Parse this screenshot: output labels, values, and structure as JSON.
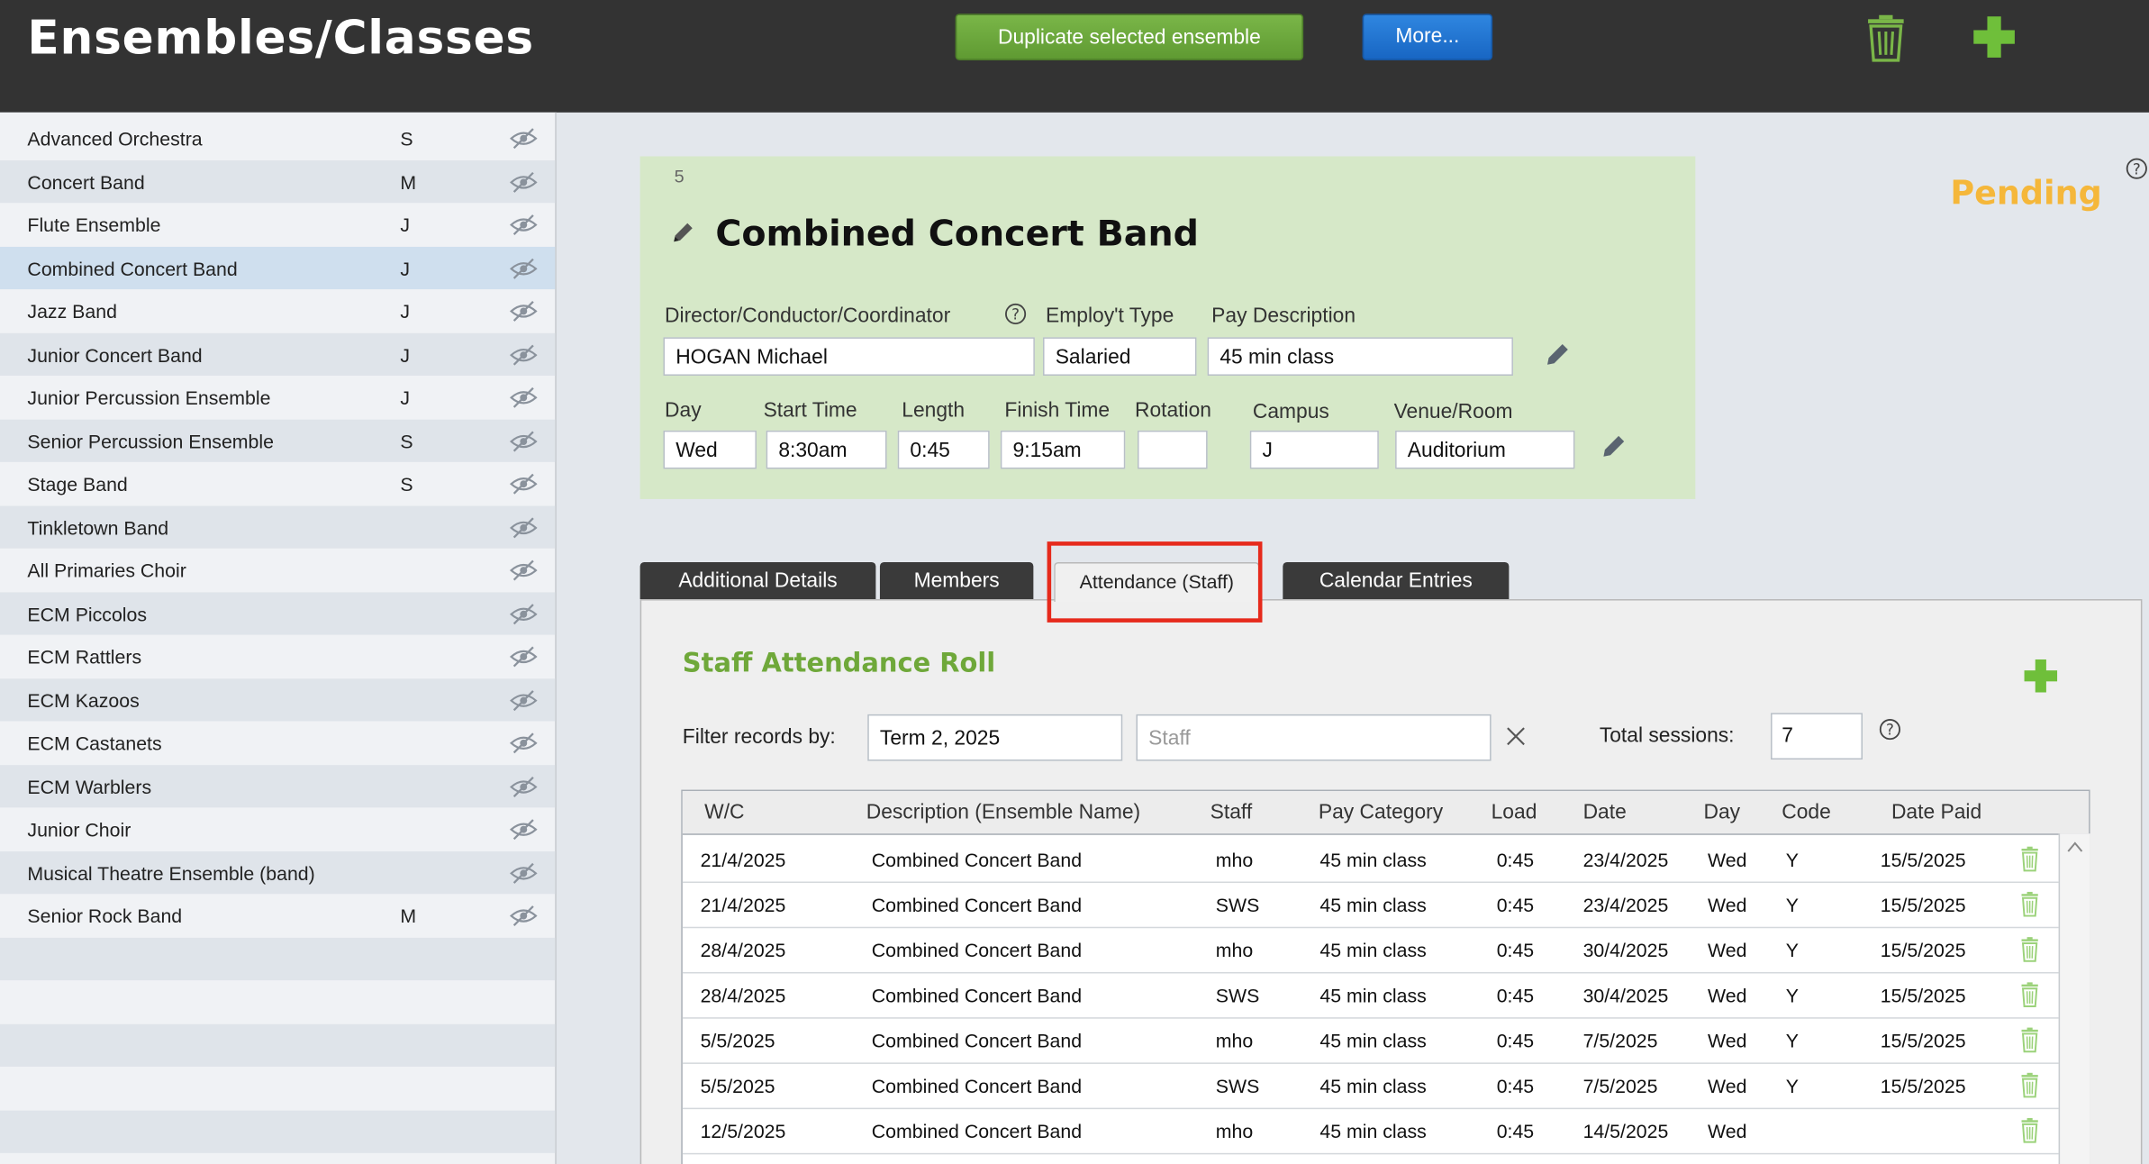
{
  "header": {
    "title": "Ensembles/Classes",
    "duplicate_label": "Duplicate selected ensemble",
    "more_label": "More...",
    "trash_icon": "trash-icon",
    "add_icon": "plus-icon"
  },
  "sidebar": {
    "items": [
      {
        "name": "Advanced Orchestra",
        "code": "S"
      },
      {
        "name": "Concert Band",
        "code": "M"
      },
      {
        "name": "Flute Ensemble",
        "code": "J"
      },
      {
        "name": "Combined Concert Band",
        "code": "J"
      },
      {
        "name": "Jazz Band",
        "code": "J"
      },
      {
        "name": "Junior Concert Band",
        "code": "J"
      },
      {
        "name": "Junior Percussion Ensemble",
        "code": "J"
      },
      {
        "name": "Senior Percussion Ensemble",
        "code": "S"
      },
      {
        "name": "Stage Band",
        "code": "S"
      },
      {
        "name": "Tinkletown Band",
        "code": ""
      },
      {
        "name": "All Primaries Choir",
        "code": ""
      },
      {
        "name": "ECM Piccolos",
        "code": ""
      },
      {
        "name": "ECM Rattlers",
        "code": ""
      },
      {
        "name": "ECM Kazoos",
        "code": ""
      },
      {
        "name": "ECM Castanets",
        "code": ""
      },
      {
        "name": "ECM Warblers",
        "code": ""
      },
      {
        "name": "Junior Choir",
        "code": ""
      },
      {
        "name": "Musical Theatre Ensemble (band)",
        "code": ""
      },
      {
        "name": "Senior Rock Band",
        "code": "M"
      }
    ]
  },
  "record": {
    "number": "5",
    "title": "Combined Concert Band",
    "status": "Pending",
    "labels": {
      "director": "Director/Conductor/Coordinator",
      "employ_type": "Employ't Type",
      "pay_desc": "Pay Description",
      "day": "Day",
      "start": "Start Time",
      "length": "Length",
      "finish": "Finish Time",
      "rotation": "Rotation",
      "campus": "Campus",
      "venue": "Venue/Room"
    },
    "values": {
      "director": "HOGAN Michael",
      "employ_type": "Salaried",
      "pay_desc": "45 min class",
      "day": "Wed",
      "start": "8:30am",
      "length": "0:45",
      "finish": "9:15am",
      "rotation": "",
      "campus": "J",
      "venue": "Auditorium"
    }
  },
  "tabs": {
    "additional": "Additional Details",
    "members": "Members",
    "attendance": "Attendance (Staff)",
    "calendar": "Calendar Entries"
  },
  "attendance": {
    "title": "Staff Attendance Roll",
    "filter_label": "Filter records by:",
    "term_value": "Term 2, 2025",
    "staff_placeholder": "Staff",
    "sessions_label": "Total sessions:",
    "sessions_value": "7",
    "columns": [
      "W/C",
      "Description (Ensemble Name)",
      "Staff",
      "Pay Category",
      "Load",
      "Date",
      "Day",
      "Code",
      "Date Paid"
    ],
    "rows": [
      {
        "wc": "21/4/2025",
        "desc": "Combined Concert Band",
        "staff": "mho",
        "pay": "45 min class",
        "load": "0:45",
        "date": "23/4/2025",
        "day": "Wed",
        "code": "Y",
        "paid": "15/5/2025"
      },
      {
        "wc": "21/4/2025",
        "desc": "Combined Concert Band",
        "staff": "SWS",
        "pay": "45 min class",
        "load": "0:45",
        "date": "23/4/2025",
        "day": "Wed",
        "code": "Y",
        "paid": "15/5/2025"
      },
      {
        "wc": "28/4/2025",
        "desc": "Combined Concert Band",
        "staff": "mho",
        "pay": "45 min class",
        "load": "0:45",
        "date": "30/4/2025",
        "day": "Wed",
        "code": "Y",
        "paid": "15/5/2025"
      },
      {
        "wc": "28/4/2025",
        "desc": "Combined Concert Band",
        "staff": "SWS",
        "pay": "45 min class",
        "load": "0:45",
        "date": "30/4/2025",
        "day": "Wed",
        "code": "Y",
        "paid": "15/5/2025"
      },
      {
        "wc": "5/5/2025",
        "desc": "Combined Concert Band",
        "staff": "mho",
        "pay": "45 min class",
        "load": "0:45",
        "date": "7/5/2025",
        "day": "Wed",
        "code": "Y",
        "paid": "15/5/2025"
      },
      {
        "wc": "5/5/2025",
        "desc": "Combined Concert Band",
        "staff": "SWS",
        "pay": "45 min class",
        "load": "0:45",
        "date": "7/5/2025",
        "day": "Wed",
        "code": "Y",
        "paid": "15/5/2025"
      },
      {
        "wc": "12/5/2025",
        "desc": "Combined Concert Band",
        "staff": "mho",
        "pay": "45 min class",
        "load": "0:45",
        "date": "14/5/2025",
        "day": "Wed",
        "code": "",
        "paid": ""
      }
    ]
  },
  "colors": {
    "header_bg": "#333333",
    "green_button": "#6aa83b",
    "blue_button": "#1f74d4",
    "pending": "#f5b73a",
    "highlight": "#e62a1c"
  }
}
